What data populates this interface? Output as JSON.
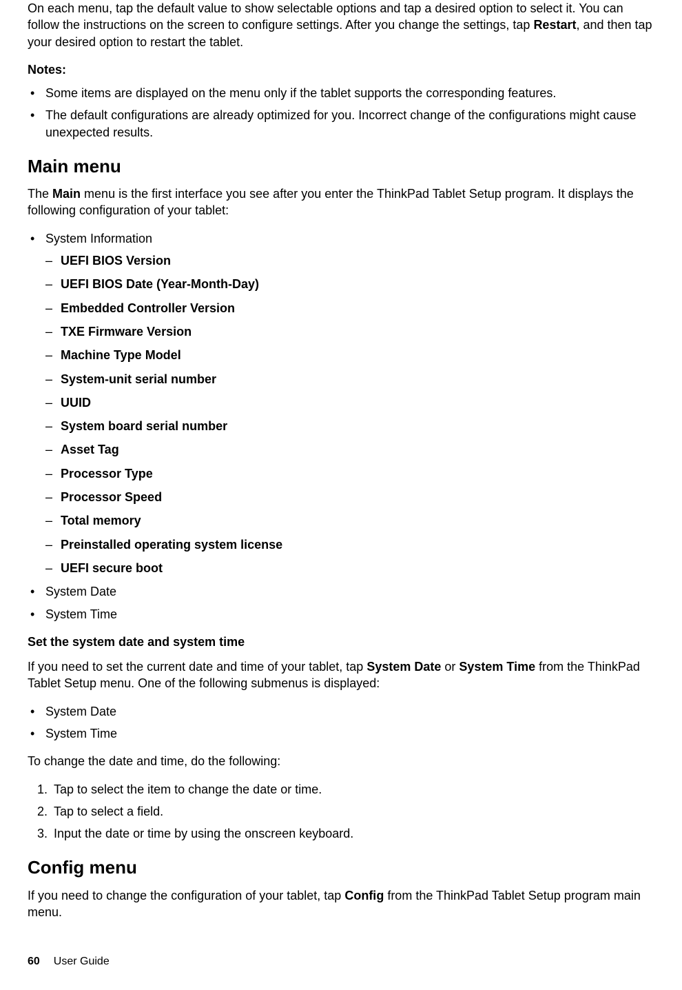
{
  "intro": {
    "p1_a": "On each menu, tap the default value to show selectable options and tap a desired option to select it. You can follow the instructions on the screen to configure settings. After you change the settings, tap ",
    "p1_b": "Restart",
    "p1_c": ", and then tap your desired option to restart the tablet."
  },
  "notes": {
    "heading": "Notes:",
    "items": [
      "Some items are displayed on the menu only if the tablet supports the corresponding features.",
      "The default configurations are already optimized for you. Incorrect change of the configurations might cause unexpected results."
    ]
  },
  "main_menu": {
    "heading": "Main menu",
    "p1_a": "The ",
    "p1_b": "Main",
    "p1_c": " menu is the first interface you see after you enter the ThinkPad Tablet Setup program. It displays the following configuration of your tablet:",
    "sysinfo_label": "System Information",
    "sysinfo_items": [
      "UEFI BIOS Version",
      "UEFI BIOS Date (Year-Month-Day)",
      "Embedded Controller Version",
      "TXE Firmware Version",
      "Machine Type Model",
      "System-unit serial number",
      "UUID",
      "System board serial number",
      "Asset Tag",
      "Processor Type",
      "Processor Speed",
      "Total memory",
      "Preinstalled operating system license",
      "UEFI secure boot"
    ],
    "extra_items": [
      "System Date",
      "System Time"
    ]
  },
  "set_dt": {
    "heading": "Set the system date and system time",
    "p1_a": "If you need to set the current date and time of your tablet, tap ",
    "p1_b": "System Date",
    "p1_c": " or ",
    "p1_d": "System Time",
    "p1_e": " from the ThinkPad Tablet Setup menu. One of the following submenus is displayed:",
    "items": [
      "System Date",
      "System Time"
    ],
    "p2": "To change the date and time, do the following:",
    "steps": [
      "Tap to select the item to change the date or time.",
      "Tap to select a field.",
      "Input the date or time by using the onscreen keyboard."
    ]
  },
  "config_menu": {
    "heading": "Config menu",
    "p1_a": "If you need to change the configuration of your tablet, tap ",
    "p1_b": "Config",
    "p1_c": " from the ThinkPad Tablet Setup program main menu."
  },
  "footer": {
    "page": "60",
    "title": "User Guide"
  }
}
